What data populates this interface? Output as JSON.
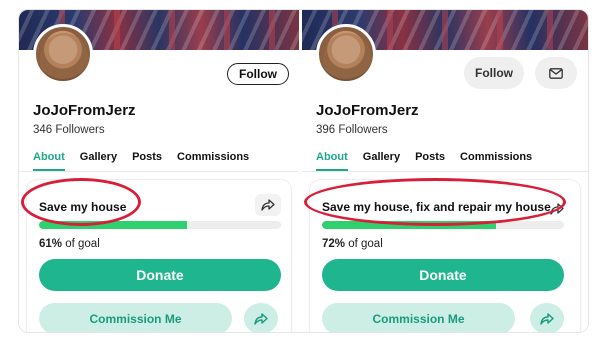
{
  "left_profile": {
    "username": "JoJoFromJerz",
    "followers": "346 Followers",
    "follow_label": "Follow",
    "tabs": [
      "About",
      "Gallery",
      "Posts",
      "Commissions"
    ],
    "card": {
      "title": "Save my house",
      "progress_fraction": 0.61,
      "goal_percent": "61%",
      "goal_suffix": "of goal",
      "donate_label": "Donate",
      "commission_label": "Commission Me"
    }
  },
  "right_profile": {
    "username": "JoJoFromJerz",
    "followers": "396 Followers",
    "follow_label": "Follow",
    "tabs": [
      "About",
      "Gallery",
      "Posts",
      "Commissions"
    ],
    "card": {
      "title": "Save my house, fix and repair my house",
      "progress_fraction": 0.72,
      "goal_percent": "72%",
      "goal_suffix": "of goal",
      "donate_label": "Donate",
      "commission_label": "Commission Me"
    }
  },
  "colors": {
    "accent": "#1fb58f",
    "progress": "#2ed16d",
    "annotation": "#d91e3a"
  },
  "icons": [
    "share-icon",
    "mail-icon",
    "avatar"
  ]
}
